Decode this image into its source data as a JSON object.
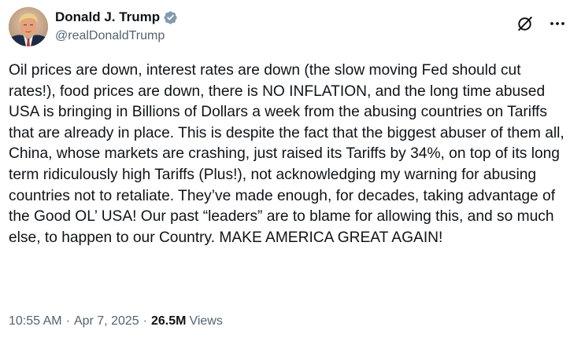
{
  "author": {
    "display_name": "Donald J. Trump",
    "handle": "@realDonaldTrump",
    "verified": true,
    "verified_color": "#829aab"
  },
  "post": {
    "text": "Oil prices are down, interest rates are down (the slow moving Fed should cut rates!), food prices are down, there is NO INFLATION, and the long time abused USA is bringing in Billions of Dollars a week from the abusing countries on Tariffs that are already in place. This is despite the fact that the biggest abuser of them all, China, whose markets are crashing, just raised its Tariffs by 34%, on top of its long term ridiculously high Tariffs (Plus!), not acknowledging my warning for abusing countries not to retaliate. They’ve made enough, for decades, taking advantage of the Good OL’ USA! Our past “leaders” are to blame for allowing this, and so much else, to happen to our Country. MAKE AMERICA GREAT AGAIN!"
  },
  "meta": {
    "time": "10:55 AM",
    "separator": "·",
    "date": "Apr 7, 2025",
    "views_count": "26.5M",
    "views_label": "Views"
  },
  "icons": {
    "grok": "grok-icon",
    "more": "more-icon",
    "verified": "verified-badge-icon"
  },
  "colors": {
    "text_primary": "#0f1419",
    "text_secondary": "#536471",
    "background": "#ffffff"
  }
}
